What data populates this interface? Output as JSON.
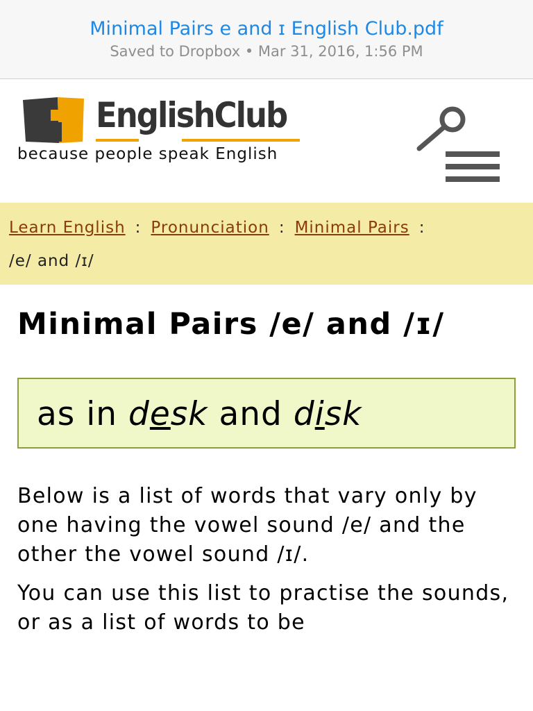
{
  "toolbar": {
    "file_title": "Minimal Pairs e and ɪ  English Club.pdf",
    "saved_to": "Saved to Dropbox",
    "separator": "•",
    "saved_time": "Mar 31, 2016, 1:56 PM"
  },
  "header": {
    "logo_text": "EnglishClub",
    "tagline": "because people speak English",
    "logo_colors": {
      "dark": "#3a3a3a",
      "accent": "#f0a300"
    }
  },
  "breadcrumb": {
    "items": [
      "Learn English",
      "Pronunciation",
      "Minimal Pairs"
    ],
    "separator": ":",
    "current": "/e/ and /ɪ/"
  },
  "main": {
    "title": "Minimal Pairs /e/ and /ɪ/",
    "example": {
      "prefix": "as in",
      "word1_start": "d",
      "word1_mark": "e",
      "word1_end": "sk",
      "conjunction": "and",
      "word2_start": "d",
      "word2_mark": "i",
      "word2_end": "sk"
    },
    "paragraph1": "Below is a list of words that vary only by one having the vowel sound /e/ and the other the vowel sound /ɪ/.",
    "paragraph2": "You can use this list to practise the sounds, or as a list of words to be"
  }
}
